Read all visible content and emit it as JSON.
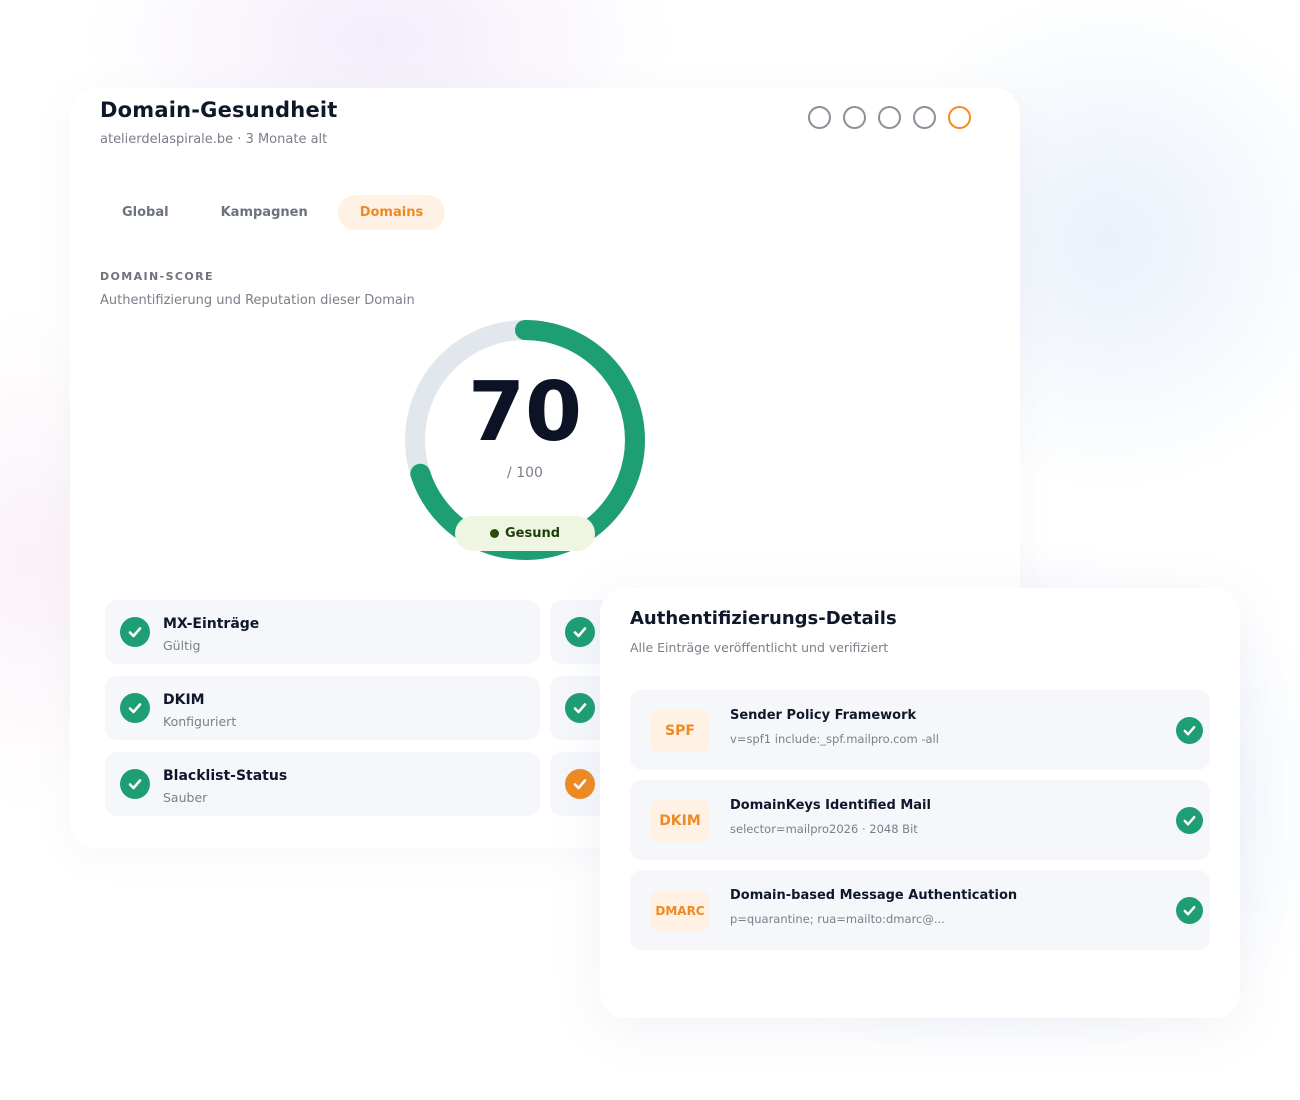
{
  "header": {
    "title": "Domain-Gesundheit",
    "subtitle": "atelierdelaspirale.be · 3 Monate alt"
  },
  "colors": {
    "accent": "#ee8a24",
    "success": "#1e9e73",
    "track": "#e2e7ee"
  },
  "tabs": [
    {
      "label": "Global",
      "active": false
    },
    {
      "label": "Kampagnen",
      "active": false
    },
    {
      "label": "Domains",
      "active": true
    }
  ],
  "score_section": {
    "label": "DOMAIN-SCORE",
    "description": "Authentifizierung und Reputation dieser Domain",
    "score": "70",
    "max": "/ 100",
    "status": "Gesund"
  },
  "checks": [
    {
      "title": "MX-Einträge",
      "subtitle": "Gültig",
      "icon": "check-icon",
      "status": "ok"
    },
    {
      "title": "DKIM",
      "subtitle": "Konfiguriert",
      "icon": "check-icon",
      "status": "ok"
    },
    {
      "title": "Blacklist-Status",
      "subtitle": "Sauber",
      "icon": "check-icon",
      "status": "ok"
    }
  ],
  "check_icons_right": [
    {
      "icon": "check-icon",
      "status": "ok"
    },
    {
      "icon": "check-icon",
      "status": "ok"
    },
    {
      "icon": "check-icon",
      "status": "warn"
    }
  ],
  "details": {
    "title": "Authentifizierungs-Details",
    "subtitle": "Alle Einträge veröffentlicht und verifiziert",
    "records": [
      {
        "tag": "SPF",
        "title": "Sender Policy Framework",
        "value": "v=spf1 include:_spf.mailpro.com -all"
      },
      {
        "tag": "DKIM",
        "title": "DomainKeys Identified Mail",
        "value": "selector=mailpro2026 · 2048 Bit"
      },
      {
        "tag": "DMARC",
        "title": "Domain-based Message Authentication",
        "value": "p=quarantine; rua=mailto:dmarc@..."
      }
    ]
  }
}
